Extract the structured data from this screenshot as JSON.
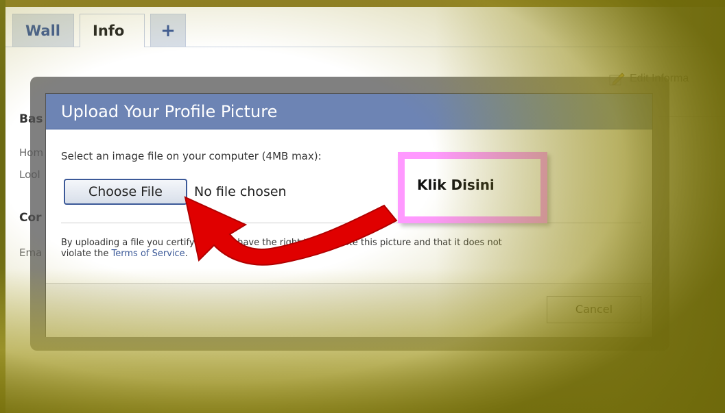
{
  "tabs": [
    {
      "label": "Wall"
    },
    {
      "label": "Info"
    },
    {
      "label": "+"
    }
  ],
  "background": {
    "section_basic": "Bas",
    "row_home": "Hom",
    "row_looking": "Lool",
    "section_contact": "Cor",
    "row_email": "Ema",
    "edit_link": "Edit Informa"
  },
  "dialog": {
    "title": "Upload Your Profile Picture",
    "prompt": "Select an image file on your computer (4MB max):",
    "choose_label": "Choose File",
    "no_file": "No file chosen",
    "note_line1": "By uploading a file you certify that you have the right to distribute this picture and that it does not",
    "note_line2_pre": "violate the ",
    "note_link": "Terms of Service",
    "note_line2_post": ".",
    "cancel_label": "Cancel"
  },
  "callout": {
    "text": "Klik Disini"
  },
  "colors": {
    "brand_blue": "#3b5998",
    "title_bar": "#6d84b4",
    "callout_border": "#ff99ff",
    "arrow": "#e00000"
  }
}
